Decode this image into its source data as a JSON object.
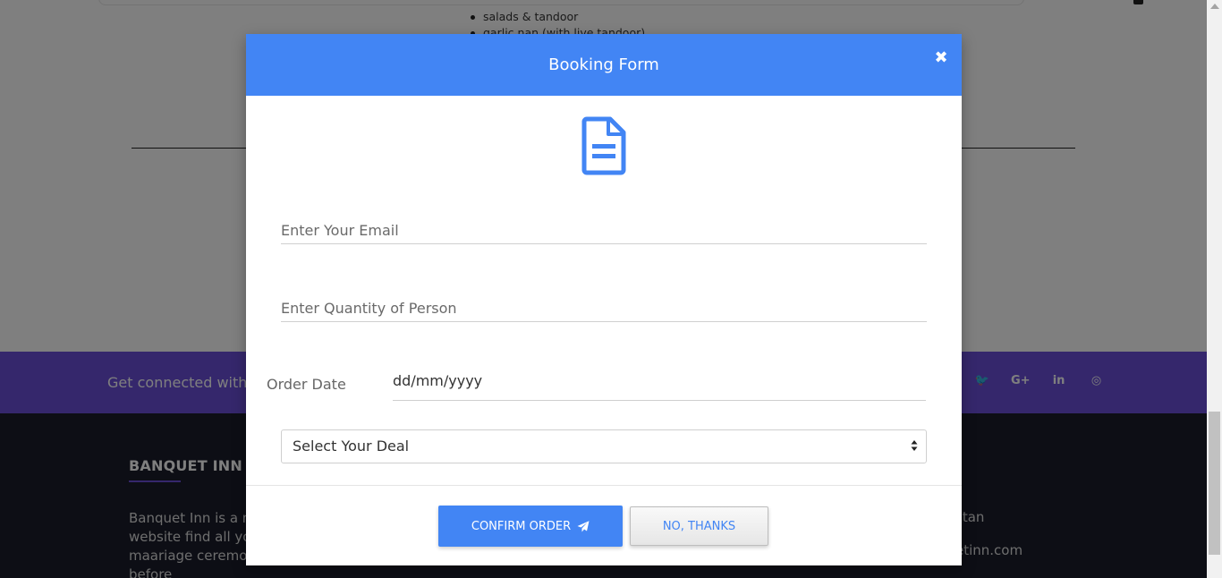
{
  "background": {
    "menu_items": [
      "salads & tandoor",
      "garlic nan (with live tandoor)"
    ],
    "connected_text": "Get connected with",
    "social_icons": [
      "twitter-icon",
      "google-plus-icon",
      "linkedin-icon",
      "instagram-icon"
    ],
    "social_glyphs": [
      "🐦",
      "G+",
      "in",
      "◎"
    ],
    "footer_brand": "BANQUET INN",
    "footer_about": "Banquet Inn is a m organizing website find all you need to maariage ceremony right before",
    "contact_line_1": "stan",
    "contact_line_2": "etinn.com"
  },
  "modal": {
    "title": "Booking Form",
    "close_glyph": "✖",
    "email_placeholder": "Enter Your Email",
    "quantity_placeholder": "Enter Quantity of Person",
    "order_date_label": "Order Date",
    "order_date_value": "dd/mm/yyyy",
    "deal_selected": "Select Your Deal",
    "confirm_label": "CONFIRM ORDER",
    "cancel_label": "NO, THANKS"
  },
  "colors": {
    "accent": "#4285f4",
    "social_band": "#6a4fd8",
    "footer_bg": "#1a1d2b"
  }
}
